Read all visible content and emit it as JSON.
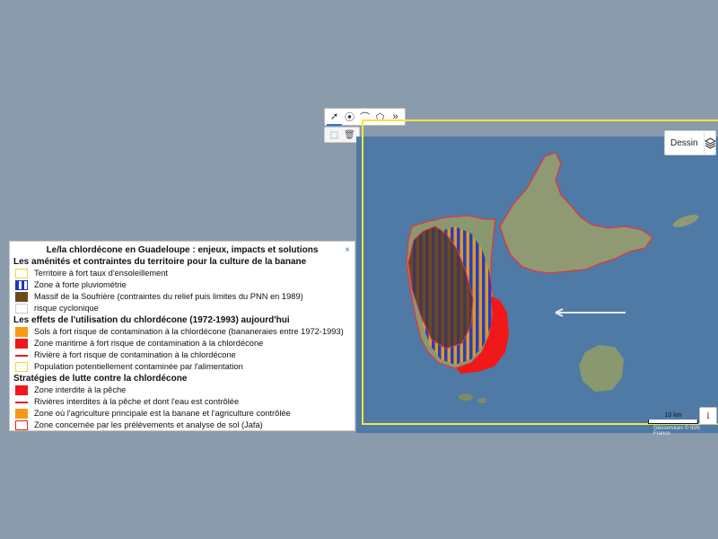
{
  "toolbar": {
    "tools": [
      {
        "name": "select-arrow-icon",
        "glyph": "➚"
      },
      {
        "name": "marker-icon",
        "glyph": "⦿"
      },
      {
        "name": "polyline-icon",
        "glyph": "⌒"
      },
      {
        "name": "polygon-icon",
        "glyph": "⬠"
      },
      {
        "name": "more-icon",
        "glyph": "»"
      }
    ],
    "secondary": [
      {
        "name": "edit-shape-icon",
        "glyph": "⬚"
      },
      {
        "name": "trash-icon",
        "glyph": "🗑"
      }
    ]
  },
  "map": {
    "dessin_label": "Dessin",
    "scale_label": "10 km",
    "attribution": "Géoservices © IGN France",
    "info_label": "i"
  },
  "legend": {
    "title": "Le/la chlordécone en Guadeloupe : enjeux, impacts et solutions",
    "close_label": "×",
    "sections": [
      {
        "heading": "Les aménités et contraintes du territoire pour la culture de la banane",
        "items": [
          {
            "label": "Territoire à fort taux d'ensoleillement",
            "swatch": "yellow-outline"
          },
          {
            "label": "Zone à forte pluviométrie",
            "swatch": "blue-stripes"
          },
          {
            "label": "Massif de la Soufrière (contraintes du relief puis limites du PNN en 1989)",
            "swatch": "brown"
          },
          {
            "label": "risque cyclonique",
            "swatch": "none"
          }
        ]
      },
      {
        "heading": "Les effets de l'utilisation du chlordécone (1972-1993) aujourd'hui",
        "items": [
          {
            "label": "Sols à fort risque de contamination à la chlordécone (bananeraies entre 1972-1993)",
            "swatch": "orange"
          },
          {
            "label": "Zone maritime à fort risque de contamination à la chlordécone",
            "swatch": "red"
          },
          {
            "label": "Rivière à fort risque de contamination à la chlordécone",
            "swatch": "red-line"
          },
          {
            "label": "Population potentiellement contaminée par l'alimentation",
            "swatch": "yellow-outline"
          }
        ]
      },
      {
        "heading": "Stratégies de lutte contre la chlordécone",
        "items": [
          {
            "label": "Zone interdite à la pêche",
            "swatch": "red"
          },
          {
            "label": "Rivières interdites à la pêche et dont l'eau est contrôlée",
            "swatch": "red-line"
          },
          {
            "label": "Zone où l'agriculture principale est la banane et l'agriculture contrôlée",
            "swatch": "orange"
          },
          {
            "label": "Zone concernée par les prélèvements et analyse de sol (Jafa)",
            "swatch": "red-outline"
          }
        ]
      }
    ]
  },
  "colors": {
    "sea": "#4f7aa6",
    "land": "#8f9a72",
    "yellow_frame": "#f5e63c",
    "contamination_red": "#f01818",
    "banana_orange": "#f59a14",
    "soufriere_brown": "#6b4a1c",
    "rain_blue": "#1a35c8"
  }
}
